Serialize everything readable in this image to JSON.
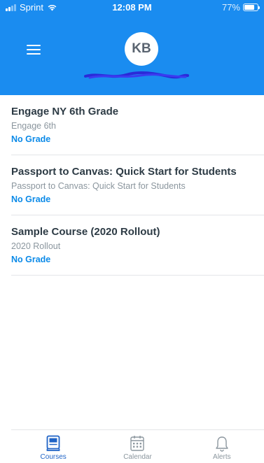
{
  "status_bar": {
    "carrier": "Sprint",
    "time": "12:08 PM",
    "battery": "77%",
    "battery_level": 0.77,
    "icons": [
      "signal-icon",
      "wifi-icon",
      "battery-icon"
    ]
  },
  "header": {
    "background_color": "#1a8cf0",
    "avatar_initials": "KB"
  },
  "courses": [
    {
      "title": "Engage NY 6th Grade",
      "subtitle": "Engage 6th",
      "grade": "No Grade"
    },
    {
      "title": "Passport to Canvas: Quick Start for Students",
      "subtitle": "Passport to Canvas: Quick Start for Students",
      "grade": "No Grade"
    },
    {
      "title": "Sample Course (2020 Rollout)",
      "subtitle": "2020 Rollout",
      "grade": "No Grade"
    }
  ],
  "tabs": [
    {
      "label": "Courses",
      "icon": "book-icon",
      "active": true
    },
    {
      "label": "Calendar",
      "icon": "calendar-icon",
      "active": false
    },
    {
      "label": "Alerts",
      "icon": "bell-icon",
      "active": false
    }
  ],
  "colors": {
    "accent": "#1a8cf0",
    "grade": "#0b8ae8",
    "active_tab": "#1f63c6",
    "inactive_tab": "#8b969e"
  }
}
